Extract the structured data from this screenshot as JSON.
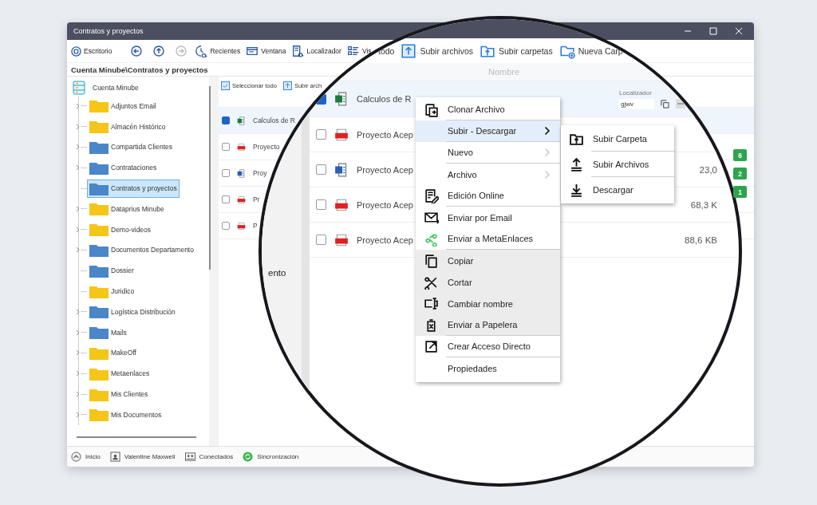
{
  "window": {
    "title": "Contratos y proyectos"
  },
  "toolbar_home": "Escritorio",
  "nav_buttons": [
    {
      "disabled": false
    },
    {
      "disabled": false
    },
    {
      "disabled": true
    }
  ],
  "toolbar": [
    "Recientes",
    "Ventana",
    "Localizador",
    "Vis"
  ],
  "path": "Cuenta Minube\\Contratos y proyectos",
  "tree": {
    "root": "Cuenta Minube",
    "children": [
      {
        "label": "Adjuntos Email",
        "color": "#f5c518",
        "expandable": true,
        "selected": false
      },
      {
        "label": "Almacén Histórico",
        "color": "#f5c518",
        "expandable": true,
        "selected": false
      },
      {
        "label": "Compartida Clientes",
        "color": "#4a86c8",
        "expandable": true,
        "selected": false
      },
      {
        "label": "Contrataciones",
        "color": "#4a86c8",
        "expandable": true,
        "selected": false
      },
      {
        "label": "Contratos y proyectos",
        "color": "#4a86c8",
        "expandable": false,
        "selected": true
      },
      {
        "label": "Dataprius Minube",
        "color": "#f5c518",
        "expandable": true,
        "selected": false
      },
      {
        "label": "Demo-videos",
        "color": "#f5c518",
        "expandable": true,
        "selected": false
      },
      {
        "label": "Documentos Departamento",
        "color": "#4a86c8",
        "expandable": true,
        "selected": false
      },
      {
        "label": "Dossier",
        "color": "#4a86c8",
        "expandable": false,
        "selected": false
      },
      {
        "label": "Juridico",
        "color": "#f5c518",
        "expandable": false,
        "selected": false
      },
      {
        "label": "Logística Distribución",
        "color": "#4a86c8",
        "expandable": true,
        "selected": false
      },
      {
        "label": "Mails",
        "color": "#4a86c8",
        "expandable": true,
        "selected": false
      },
      {
        "label": "MakeOff",
        "color": "#f5c518",
        "expandable": true,
        "selected": false
      },
      {
        "label": "Metaenlaces",
        "color": "#f5c518",
        "expandable": true,
        "selected": false
      },
      {
        "label": "Mis Clientes",
        "color": "#f5c518",
        "expandable": true,
        "selected": false
      },
      {
        "label": "Mis Documentos",
        "color": "#f5c518",
        "expandable": true,
        "selected": false
      }
    ]
  },
  "file_pane": {
    "actions": [
      "Seleccionar todo",
      "Subir arch"
    ],
    "rows": [
      {
        "name": "Calculos de R",
        "kind": "excel",
        "checked": true,
        "selected": true
      },
      {
        "name": "Proyecto",
        "kind": "pdf",
        "checked": false,
        "selected": false
      },
      {
        "name": "Proy",
        "kind": "word",
        "checked": false,
        "selected": false
      },
      {
        "name": "Pr",
        "kind": "pdf",
        "checked": false,
        "selected": false
      },
      {
        "name": "P",
        "kind": "pdf",
        "checked": false,
        "selected": false
      }
    ],
    "footer_text": "ento"
  },
  "magnifier": {
    "toolbar": [
      "todo",
      "Subir archivos",
      "Subir carpetas",
      "Nueva Carp"
    ],
    "column_header": "Nombre",
    "locator_label": "Localizador",
    "locator_value": "gjwv",
    "rows": [
      {
        "name": "Calculos de R",
        "kind": "excel",
        "checked": true,
        "selected": true
      },
      {
        "name": "Proyecto Acep",
        "kind": "pdf",
        "checked": false,
        "selected": false
      },
      {
        "name": "Proyecto Acep",
        "kind": "word",
        "checked": false,
        "selected": false,
        "size": "23,0"
      },
      {
        "name": "Proyecto Acep",
        "kind": "pdf",
        "checked": false,
        "selected": false,
        "size": "68,3 K"
      },
      {
        "name": "Proyecto Acep",
        "kind": "pdf",
        "checked": false,
        "selected": false,
        "size": "88,6 KB"
      }
    ]
  },
  "badges": [
    "6",
    "2",
    "1"
  ],
  "context_menu": {
    "items": [
      {
        "label": "Clonar Archivo",
        "kind": "item",
        "selected": false,
        "shaded": false,
        "separator_after": true
      },
      {
        "label": "Subir - Descargar",
        "kind": "submenu",
        "selected": true,
        "shaded": false,
        "separator_after": true
      },
      {
        "label": "Nuevo",
        "kind": "submenu",
        "selected": false,
        "shaded": false,
        "separator_after": true
      },
      {
        "label": "Archivo",
        "kind": "submenu",
        "selected": false,
        "shaded": false,
        "separator_after": false
      },
      {
        "label": "Edición Online",
        "kind": "item",
        "selected": false,
        "shaded": false,
        "separator_after": true
      },
      {
        "label": "Enviar por Email",
        "kind": "item",
        "selected": false,
        "shaded": false,
        "separator_after": false
      },
      {
        "label": "Enviar a MetaEnlaces",
        "kind": "item",
        "selected": false,
        "shaded": false,
        "separator_after": true
      },
      {
        "label": "Copiar",
        "kind": "item",
        "selected": false,
        "shaded": true,
        "separator_after": false
      },
      {
        "label": "Cortar",
        "kind": "item",
        "selected": false,
        "shaded": true,
        "separator_after": false
      },
      {
        "label": "Cambiar nombre",
        "kind": "item",
        "selected": false,
        "shaded": true,
        "separator_after": false
      },
      {
        "label": "Enviar a Papelera",
        "kind": "item",
        "selected": false,
        "shaded": true,
        "separator_after": true
      },
      {
        "label": "Crear Acceso Directo",
        "kind": "item",
        "selected": false,
        "shaded": false,
        "separator_after": true
      },
      {
        "label": "Propiedades",
        "kind": "item",
        "selected": false,
        "shaded": false,
        "separator_after": false
      }
    ]
  },
  "submenu": {
    "items": [
      "Subir Carpeta",
      "Subir Archivos",
      "Descargar"
    ]
  },
  "status_bar": [
    "Inicio",
    "Valentine Maxwell",
    "Conectados",
    "Sincronización"
  ]
}
